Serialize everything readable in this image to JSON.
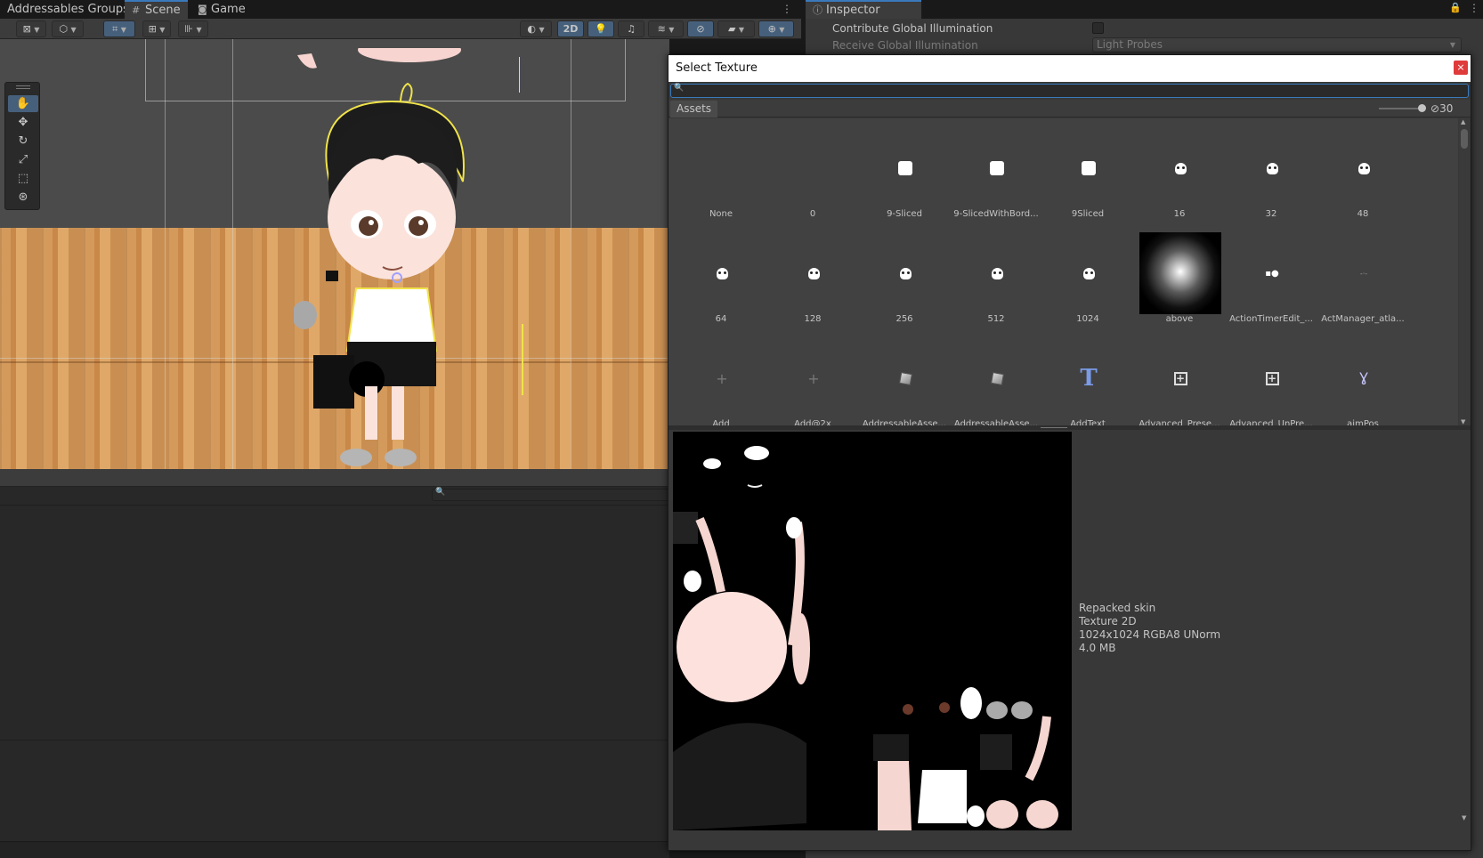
{
  "tabs": {
    "addressables": "Addressables Groups",
    "scene": "Scene",
    "game": "Game",
    "inspector": "Inspector"
  },
  "scene_toolbar": {
    "mode_2d": "2D"
  },
  "inspector": {
    "contribute_gi": "Contribute Global Illumination",
    "receive_gi": "Receive Global Illumination",
    "receive_gi_value": "Light Probes"
  },
  "dialog": {
    "title": "Select Texture",
    "close": "×",
    "search_value": "",
    "tab_assets": "Assets",
    "visible_count": "30",
    "items": [
      {
        "label": "None",
        "icon": "none"
      },
      {
        "label": "0",
        "icon": "none"
      },
      {
        "label": "9-Sliced",
        "icon": "white-square"
      },
      {
        "label": "9-SlicedWithBord...",
        "icon": "white-square"
      },
      {
        "label": "9Sliced",
        "icon": "white-square"
      },
      {
        "label": "16",
        "icon": "skull"
      },
      {
        "label": "32",
        "icon": "skull"
      },
      {
        "label": "48",
        "icon": "skull"
      },
      {
        "label": "64",
        "icon": "skull"
      },
      {
        "label": "128",
        "icon": "skull"
      },
      {
        "label": "256",
        "icon": "skull"
      },
      {
        "label": "512",
        "icon": "skull"
      },
      {
        "label": "1024",
        "icon": "skull"
      },
      {
        "label": "above",
        "icon": "glow"
      },
      {
        "label": "ActionTimerEdit_...",
        "icon": "small-dots"
      },
      {
        "label": "ActManager_atla...",
        "icon": "tiny-sprite"
      },
      {
        "label": "Add",
        "icon": "plus"
      },
      {
        "label": "Add@2x",
        "icon": "plus"
      },
      {
        "label": "AddressableAsse...",
        "icon": "cube"
      },
      {
        "label": "AddressableAsse...",
        "icon": "cube"
      },
      {
        "label": "AddText",
        "icon": "T"
      },
      {
        "label": "Advanced_Prese...",
        "icon": "boxplus"
      },
      {
        "label": "Advanced_UnPre...",
        "icon": "boxplus"
      },
      {
        "label": "aimPos",
        "icon": "anim"
      }
    ],
    "preview": {
      "name": "Repacked skin",
      "type": "Texture 2D",
      "format": "1024x1024  RGBA8 UNorm",
      "size": "4.0 MB"
    }
  },
  "colors": {
    "accent": "#3a79bb",
    "active_tool": "#46607c",
    "close": "#e03b3b"
  }
}
